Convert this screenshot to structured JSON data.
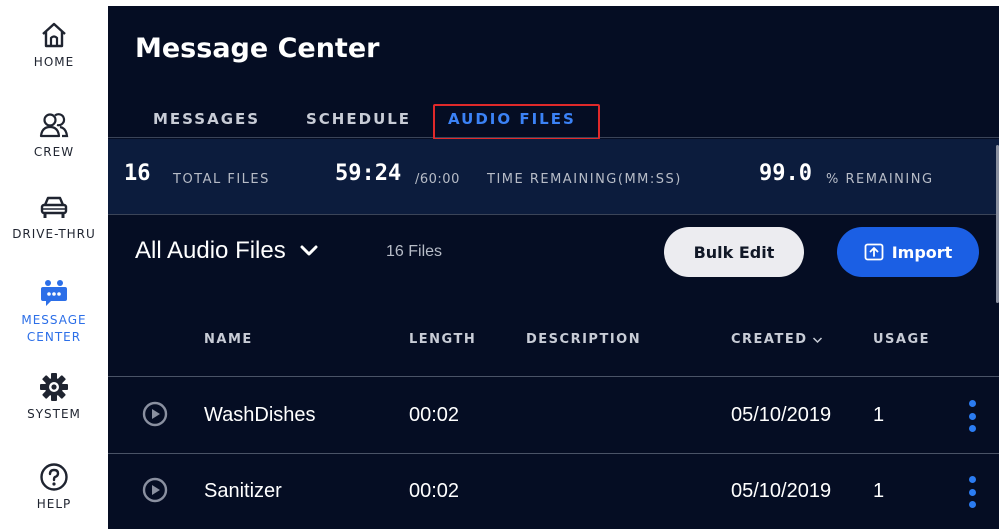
{
  "sidebar": {
    "items": [
      {
        "label": "HOME",
        "icon": "home-icon"
      },
      {
        "label": "CREW",
        "icon": "crew-icon"
      },
      {
        "label": "DRIVE-THRU",
        "icon": "car-icon"
      },
      {
        "label": "MESSAGE CENTER",
        "label_line1": "MESSAGE",
        "label_line2": "CENTER",
        "icon": "message-center-icon",
        "active": true
      },
      {
        "label": "SYSTEM",
        "icon": "gear-icon"
      },
      {
        "label": "HELP",
        "icon": "help-icon"
      }
    ]
  },
  "page": {
    "title": "Message Center"
  },
  "tabs": [
    {
      "label": "MESSAGES",
      "active": false
    },
    {
      "label": "SCHEDULE",
      "active": false
    },
    {
      "label": "AUDIO FILES",
      "active": true
    }
  ],
  "stats": {
    "total_files": "16",
    "total_files_label": "TOTAL FILES",
    "time_remaining": "59:24",
    "time_total": "/60:00",
    "time_label": "TIME REMAINING(MM:SS)",
    "percent": "99.0",
    "percent_label": "% REMAINING"
  },
  "toolbar": {
    "filter_label": "All Audio Files",
    "file_count": "16 Files",
    "bulk_edit_label": "Bulk Edit",
    "import_label": "Import"
  },
  "table": {
    "headers": {
      "name": "NAME",
      "length": "LENGTH",
      "description": "DESCRIPTION",
      "created": "CREATED",
      "usage": "USAGE"
    },
    "rows": [
      {
        "name": "WashDishes",
        "length": "00:02",
        "description": "",
        "created": "05/10/2019",
        "usage": "1"
      },
      {
        "name": "Sanitizer",
        "length": "00:02",
        "description": "",
        "created": "05/10/2019",
        "usage": "1"
      }
    ]
  },
  "colors": {
    "accent": "#2c6fe8",
    "background": "#050d23",
    "stats_band": "#0c1c3d",
    "highlight_border": "#e0292a"
  }
}
